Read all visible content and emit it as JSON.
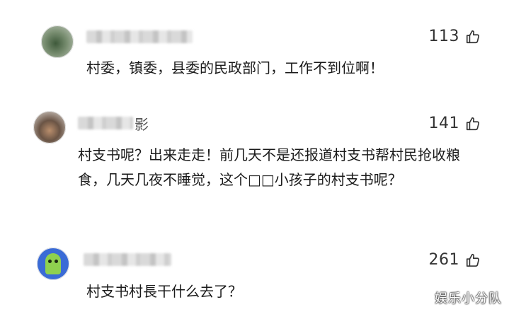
{
  "comments": [
    {
      "username_tail": "",
      "likes": "113",
      "text": "村委，镇委，县委的民政部门，工作不到位啊！"
    },
    {
      "username_tail": "影",
      "likes": "141",
      "text": "村支书呢？出来走走！前几天不是还报道村支书帮村民抢收粮食，几天几夜不睡觉，这个□□小孩子的村支书呢？"
    },
    {
      "username_tail": "",
      "likes": "261",
      "text": "村支书村長干什么去了？"
    }
  ],
  "icons": {
    "like": "thumbs-up-icon"
  },
  "watermark": "娱乐小分队"
}
